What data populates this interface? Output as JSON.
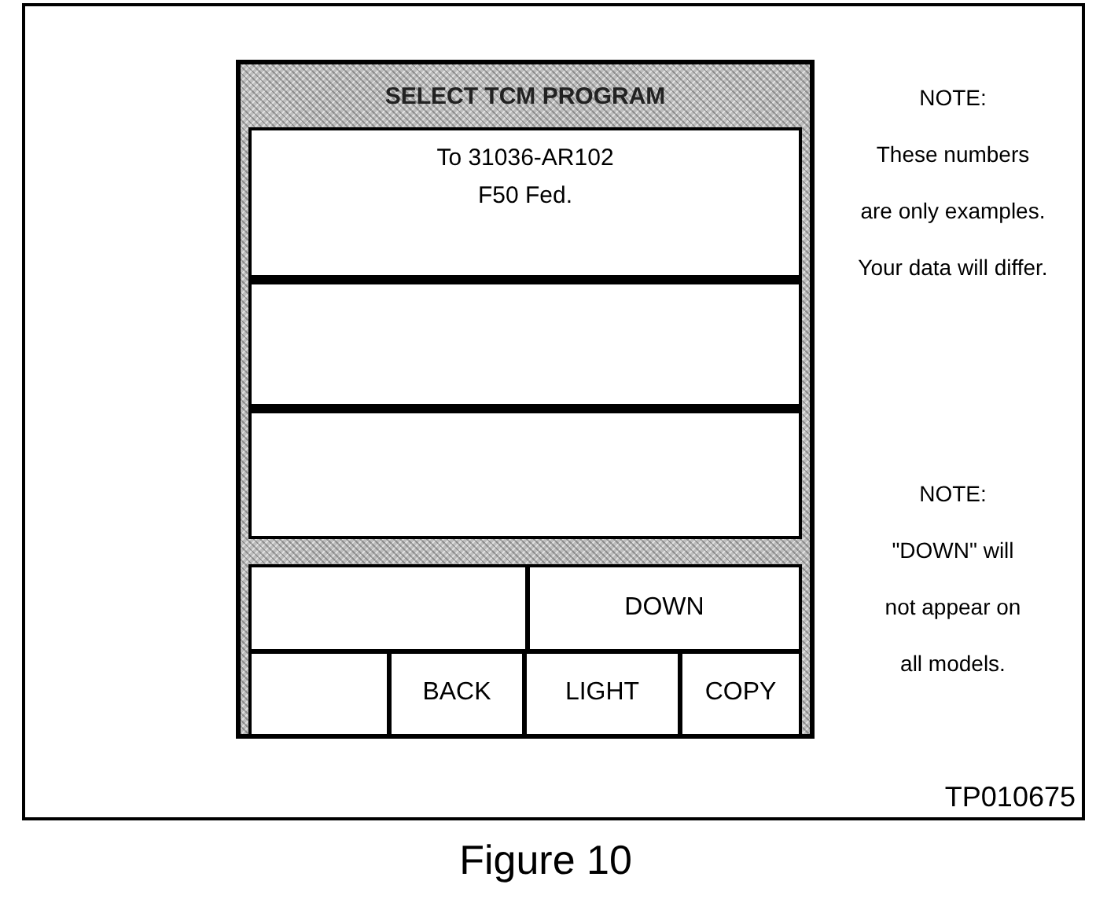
{
  "screen": {
    "title": "SELECT TCM PROGRAM",
    "rows": [
      {
        "kind": "text",
        "lines": [
          "To 31036-AR102",
          "F50 Fed."
        ]
      },
      {
        "kind": "blank"
      },
      {
        "kind": "blank"
      }
    ],
    "button_rows": [
      [
        {
          "kind": "blank"
        },
        {
          "kind": "button",
          "label": "DOWN"
        }
      ],
      [
        {
          "kind": "blank"
        },
        {
          "kind": "button",
          "label": "BACK"
        },
        {
          "kind": "button",
          "label": "LIGHT"
        },
        {
          "kind": "button",
          "label": "COPY"
        }
      ]
    ]
  },
  "notes": [
    {
      "title": "NOTE:",
      "lines": [
        "These numbers",
        "are only examples.",
        "Your data will differ."
      ]
    },
    {
      "title": "NOTE:",
      "lines": [
        "\"DOWN\" will",
        "not appear on",
        "all models."
      ]
    }
  ],
  "figure_id": "TP010675",
  "caption": "Figure 10"
}
